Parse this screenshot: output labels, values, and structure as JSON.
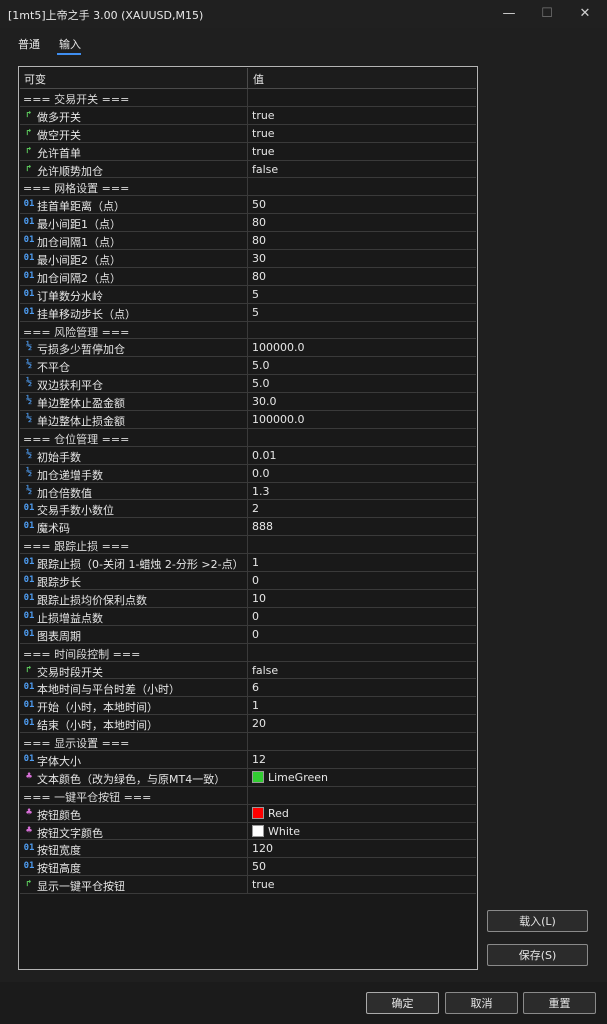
{
  "window": {
    "title": "[1mt5]上帝之手 3.00 (XAUUSD,M15)",
    "minimize": "—",
    "maximize": "☐",
    "close": "✕"
  },
  "tabs": [
    "普通",
    "输入"
  ],
  "grid": {
    "col_variable": "可变",
    "col_value": "值"
  },
  "rows": [
    {
      "type": "section",
      "name": "=== 交易开关 ==="
    },
    {
      "type": "bool",
      "name": "做多开关",
      "value": "true"
    },
    {
      "type": "bool",
      "name": "做空开关",
      "value": "true"
    },
    {
      "type": "bool",
      "name": "允许首单",
      "value": "true"
    },
    {
      "type": "bool",
      "name": "允许顺势加仓",
      "value": "false"
    },
    {
      "type": "section",
      "name": "=== 网格设置 ==="
    },
    {
      "type": "int",
      "name": "挂首单距离（点）",
      "value": "50"
    },
    {
      "type": "int",
      "name": "最小间距1（点）",
      "value": "80"
    },
    {
      "type": "int",
      "name": "加仓间隔1（点）",
      "value": "80"
    },
    {
      "type": "int",
      "name": "最小间距2（点）",
      "value": "30"
    },
    {
      "type": "int",
      "name": "加仓间隔2（点）",
      "value": "80"
    },
    {
      "type": "int",
      "name": "订单数分水岭",
      "value": "5"
    },
    {
      "type": "int",
      "name": "挂单移动步长（点）",
      "value": "5"
    },
    {
      "type": "section",
      "name": "=== 风险管理 ==="
    },
    {
      "type": "frac",
      "name": "亏损多少暂停加仓",
      "value": "100000.0"
    },
    {
      "type": "frac",
      "name": "不平仓",
      "value": "5.0"
    },
    {
      "type": "frac",
      "name": "双边获利平仓",
      "value": "5.0"
    },
    {
      "type": "frac",
      "name": "单边整体止盈金额",
      "value": "30.0"
    },
    {
      "type": "frac",
      "name": "单边整体止损金额",
      "value": "100000.0"
    },
    {
      "type": "section",
      "name": "=== 仓位管理 ==="
    },
    {
      "type": "frac",
      "name": "初始手数",
      "value": "0.01"
    },
    {
      "type": "frac",
      "name": "加仓递增手数",
      "value": "0.0"
    },
    {
      "type": "frac",
      "name": "加仓倍数值",
      "value": "1.3"
    },
    {
      "type": "int",
      "name": "交易手数小数位",
      "value": "2"
    },
    {
      "type": "int",
      "name": "魔术码",
      "value": "888"
    },
    {
      "type": "section",
      "name": "=== 跟踪止损 ==="
    },
    {
      "type": "int",
      "name": "跟踪止损（0-关闭 1-蜡烛 2-分形 >2-点）",
      "value": "1"
    },
    {
      "type": "int",
      "name": "跟踪步长",
      "value": "0"
    },
    {
      "type": "int",
      "name": "跟踪止损均价保利点数",
      "value": "10"
    },
    {
      "type": "int",
      "name": "止损增益点数",
      "value": "0"
    },
    {
      "type": "int",
      "name": "图表周期",
      "value": "0"
    },
    {
      "type": "section",
      "name": "=== 时间段控制 ==="
    },
    {
      "type": "bool",
      "name": "交易时段开关",
      "value": "false"
    },
    {
      "type": "int",
      "name": "本地时间与平台时差（小时）",
      "value": "6"
    },
    {
      "type": "int",
      "name": "开始（小时，本地时间）",
      "value": "1"
    },
    {
      "type": "int",
      "name": "结束（小时，本地时间）",
      "value": "20"
    },
    {
      "type": "section",
      "name": "=== 显示设置 ==="
    },
    {
      "type": "int",
      "name": "字体大小",
      "value": "12"
    },
    {
      "type": "color",
      "name": "文本颜色（改为绿色，与原MT4一致）",
      "value": "LimeGreen",
      "swatch": "#32cd32"
    },
    {
      "type": "section",
      "name": "=== 一键平仓按钮 ==="
    },
    {
      "type": "color",
      "name": "按钮颜色",
      "value": "Red",
      "swatch": "#ff0000"
    },
    {
      "type": "color",
      "name": "按钮文字颜色",
      "value": "White",
      "swatch": "#ffffff"
    },
    {
      "type": "int",
      "name": "按钮宽度",
      "value": "120"
    },
    {
      "type": "int",
      "name": "按钮高度",
      "value": "50"
    },
    {
      "type": "bool",
      "name": "显示一键平仓按钮",
      "value": "true"
    }
  ],
  "icons": {
    "bool": "bool-arrow-icon",
    "int": "int-01-icon",
    "frac": "fraction-icon",
    "color": "color-palette-icon"
  },
  "buttons": {
    "load": "载入(L)",
    "save": "保存(S)",
    "ok": "确定",
    "cancel": "取消",
    "reset": "重置"
  }
}
